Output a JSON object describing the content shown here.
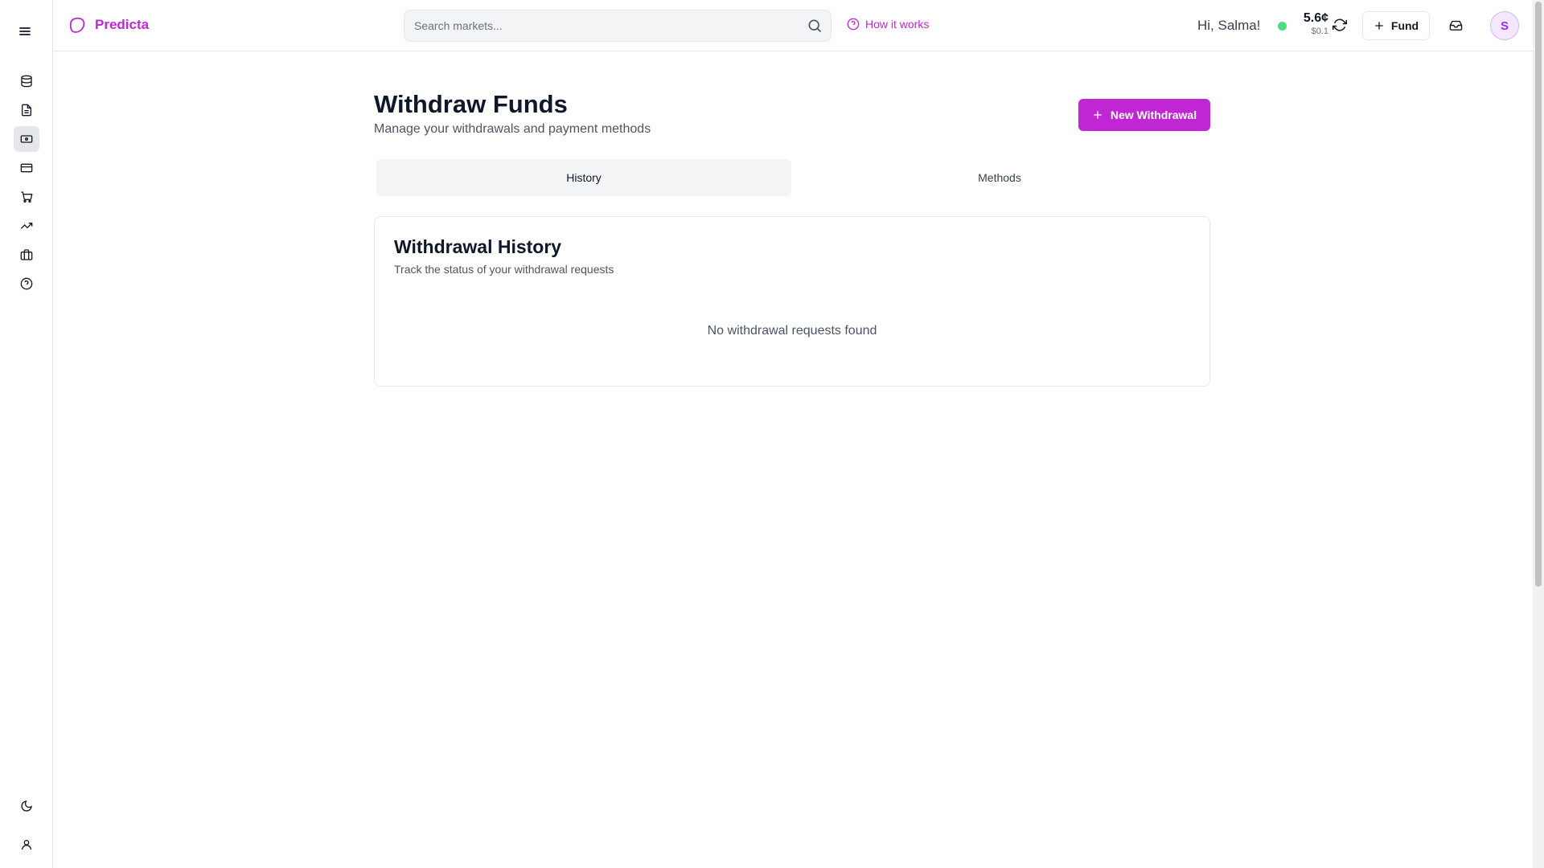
{
  "app": {
    "name": "Predicta"
  },
  "header": {
    "search_placeholder": "Search markets...",
    "how_it_works": "How it works",
    "greeting": "Hi, Salma!",
    "balance_main": "5.6¢",
    "balance_sub": "$0.1",
    "fund_label": "Fund",
    "avatar_initial": "S",
    "status_color": "#4ade80"
  },
  "sidebar": {
    "items": [
      {
        "icon": "database-icon"
      },
      {
        "icon": "document-icon"
      },
      {
        "icon": "banknote-icon",
        "active": true
      },
      {
        "icon": "credit-card-icon"
      },
      {
        "icon": "cart-icon"
      },
      {
        "icon": "trending-up-icon"
      },
      {
        "icon": "briefcase-icon"
      },
      {
        "icon": "help-circle-icon"
      }
    ],
    "bottom": [
      {
        "icon": "moon-icon"
      },
      {
        "icon": "user-icon"
      }
    ]
  },
  "page": {
    "title": "Withdraw Funds",
    "subtitle": "Manage your withdrawals and payment methods",
    "new_button": "New Withdrawal",
    "tabs": [
      {
        "label": "History",
        "active": true
      },
      {
        "label": "Methods",
        "active": false
      }
    ],
    "card": {
      "title": "Withdrawal History",
      "subtitle": "Track the status of your withdrawal requests",
      "empty_message": "No withdrawal requests found"
    }
  },
  "colors": {
    "accent": "#c026d3"
  }
}
